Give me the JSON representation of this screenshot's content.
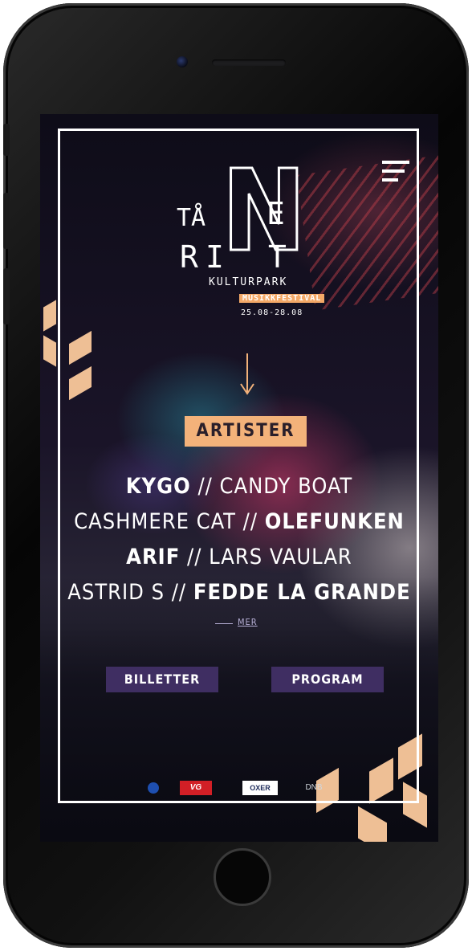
{
  "header": {
    "menu_icon": "hamburger-menu-icon"
  },
  "logo": {
    "letters_left_top": "TÅ",
    "letters_big": "N",
    "letters_right_top": "E",
    "letters_left_bottom": "R",
    "letters_left_bottom2": "I",
    "letters_right_bottom": "T",
    "subtitle": "KULTURPARK",
    "tag": "MUSIKKFESTIVAL",
    "dates": "25.08-28.08"
  },
  "artists": {
    "heading": "ARTISTER",
    "lines": [
      {
        "a": "KYGO",
        "sep": " // ",
        "b": "CANDY BOAT",
        "bold": "a"
      },
      {
        "a": "CASHMERE CAT",
        "sep": " // ",
        "b": "OLEFUNKEN",
        "bold": "b"
      },
      {
        "a": "ARIF",
        "sep": " // ",
        "b": "LARS VAULAR",
        "bold": "a"
      },
      {
        "a": "ASTRID S",
        "sep": " // ",
        "b": "FEDDE LA GRANDE",
        "bold": "b"
      }
    ],
    "more_label": "MER"
  },
  "actions": {
    "tickets_label": "BILLETTER",
    "program_label": "PROGRAM"
  },
  "sponsors": [
    {
      "name": "VG"
    },
    {
      "name": "OXER"
    },
    {
      "name": "DNB"
    }
  ],
  "colors": {
    "accent_orange": "#f3b27a",
    "button_purple": "#3f2e62",
    "frame_white": "#ffffff"
  }
}
